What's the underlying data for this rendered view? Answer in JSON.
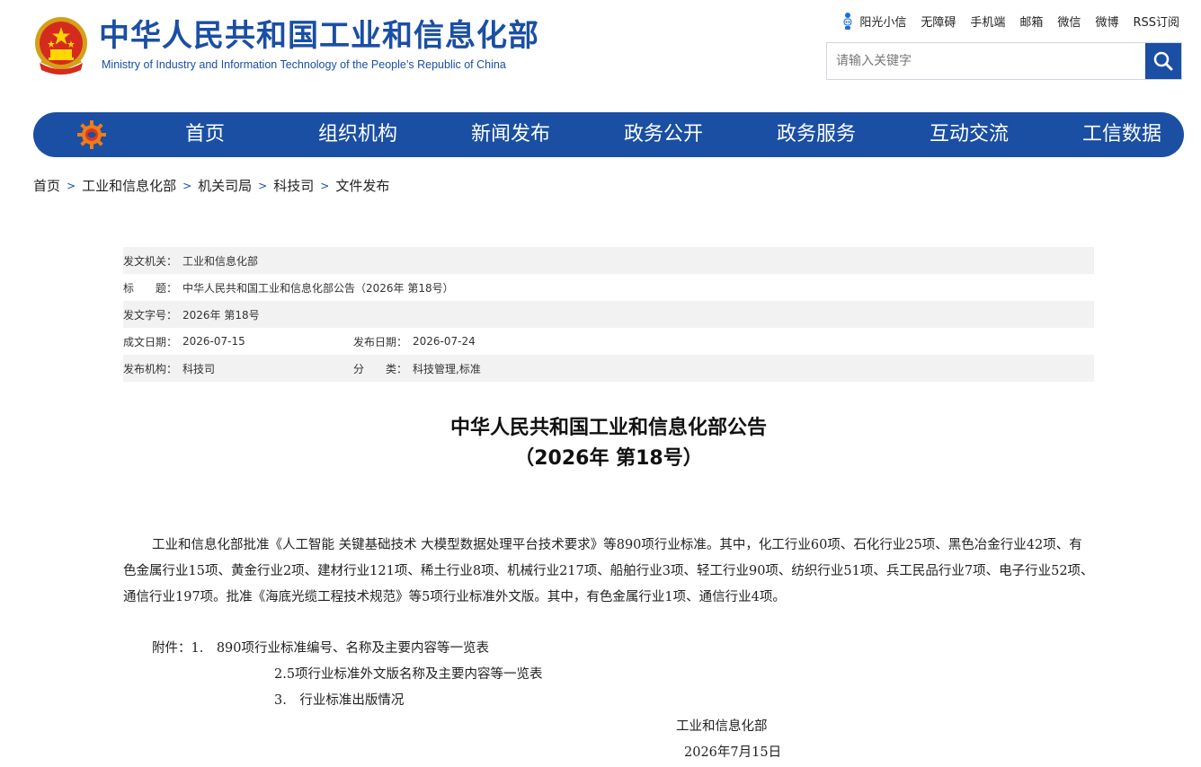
{
  "header": {
    "title_cn": "中华人民共和国工业和信息化部",
    "title_en": "Ministry of Industry and Information Technology of the People’s Republic of China",
    "top_links": [
      "阳光小信",
      "无障碍",
      "手机端",
      "邮箱",
      "微信",
      "微博",
      "RSS订阅"
    ],
    "search_placeholder": "请输入关键字"
  },
  "nav": {
    "items": [
      "首页",
      "组织机构",
      "新闻发布",
      "政务公开",
      "政务服务",
      "互动交流",
      "工信数据"
    ]
  },
  "breadcrumb": [
    "首页",
    "工业和信息化部",
    "机关司局",
    "科技司",
    "文件发布"
  ],
  "meta": {
    "issuer_label": "发文机关：",
    "issuer": "工业和信息化部",
    "title_label": "标　　题：",
    "title": "中华人民共和国工业和信息化部公告（2026年 第18号）",
    "docno_label": "发文字号：",
    "docno": "2026年 第18号",
    "created_label": "成文日期：",
    "created": "2026-07-15",
    "published_label": "发布日期：",
    "published": "2026-07-24",
    "org_label": "发布机构：",
    "org": "科技司",
    "category_label": "分　　类：",
    "category": "科技管理,标准"
  },
  "doc": {
    "title_line1": "中华人民共和国工业和信息化部公告",
    "title_line2": "（2026年 第18号）",
    "body": "工业和信息化部批准《人工智能 关键基础技术 大模型数据处理平台技术要求》等890项行业标准。其中，化工行业60项、石化行业25项、黑色冶金行业42项、有色金属行业15项、黄金行业2项、建材行业121项、稀土行业8项、机械行业217项、船舶行业3项、轻工行业90项、纺织行业51项、兵工民品行业7项、电子行业52项、通信行业197项。批准《海底光缆工程技术规范》等5项行业标准外文版。其中，有色金属行业1项、通信行业4项。",
    "attach_label": "附件：1.　890项行业标准编号、名称及主要内容等一览表",
    "attach_2": "2.5项行业标准外文版名称及主要内容等一览表",
    "attach_3": "3.　行业标准出版情况",
    "signer": "工业和信息化部",
    "sign_date": "2026年7月15日"
  },
  "colors": {
    "brand_blue": "#1a4fa3",
    "meta_shade": "#f2f2f2"
  }
}
